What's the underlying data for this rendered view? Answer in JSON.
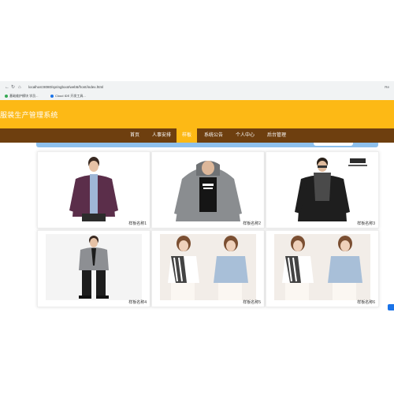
{
  "browser": {
    "url": "localhost:8080/springboot/web5/front/index.html",
    "extension_label": "Re",
    "bookmarks": [
      "基础维护模块 学员...",
      "Cloud IDE 开发工具..."
    ]
  },
  "header": {
    "title": "服装生产管理系统"
  },
  "nav": {
    "items": [
      "首页",
      "人事安排",
      "样板",
      "系统公告",
      "个人中心",
      "后台管理"
    ],
    "active_index": 2
  },
  "products": [
    {
      "caption": "样板名称1",
      "image": "maroon-cardigan-man"
    },
    {
      "caption": "样板名称2",
      "image": "grey-hoodie-man"
    },
    {
      "caption": "样板名称3",
      "image": "black-jacket-scarf-man"
    },
    {
      "caption": "样板名称4",
      "image": "grey-suit-man"
    },
    {
      "caption": "样板名称5",
      "image": "striped-top-woman"
    },
    {
      "caption": "样板名称6",
      "image": "striped-top-woman"
    }
  ],
  "colors": {
    "header_bg": "#fdb915",
    "nav_bg": "#6e3f0f",
    "nav_active_bg": "#fdb915",
    "underbar": "#8ec0ec"
  }
}
